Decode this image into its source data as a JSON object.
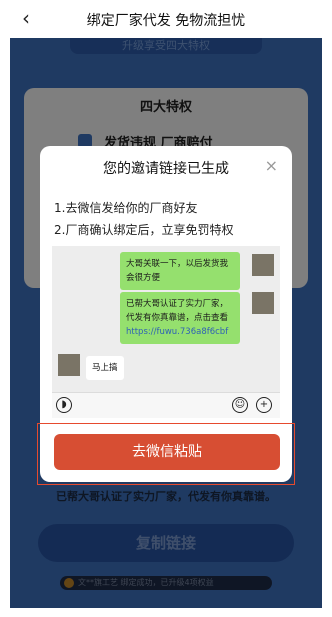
{
  "header": {
    "back_icon": "‹",
    "title": "绑定厂家代发 免物流担忧"
  },
  "background": {
    "banner": "升级享受四大特权",
    "card_title": "四大特权",
    "feature_1": "发货违规 厂商赔付",
    "below_text": "已帮大哥认证了实力厂家，代发有你真靠谱。",
    "copy_button": "复制链接",
    "footer_note": "文**旗工艺 绑定成功，已升级4项权益"
  },
  "modal": {
    "title": "您的邀请链接已生成",
    "close": "×",
    "step_1": "1.去微信发给你的厂商好友",
    "step_2": "2.厂商确认绑定后，立享免罚特权",
    "chat": {
      "message_1": "大哥关联一下，以后发货我会很方便",
      "message_2_text": "已帮大哥认证了实力厂家，代发有你真靠谱，点击查看",
      "message_2_link": "https://fuwu.736a8f6cbf",
      "reply": "马上搞"
    },
    "paste_button": "去微信粘贴"
  },
  "colors": {
    "brand_blue": "#3f74c5",
    "paste_red": "#d74e33",
    "bubble_green": "#95e06e"
  }
}
